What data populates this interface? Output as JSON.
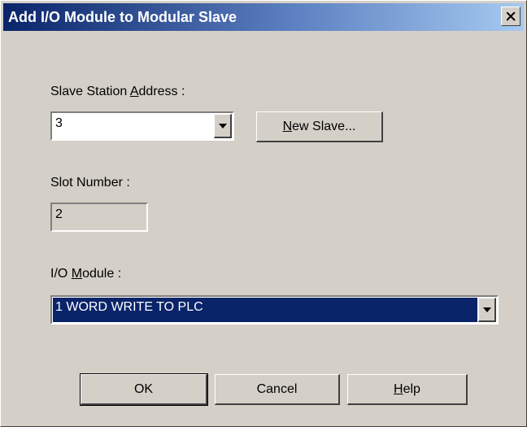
{
  "window": {
    "title": "Add I/O Module to Modular Slave"
  },
  "slave_address": {
    "label_before": "Slave Station ",
    "label_access": "A",
    "label_after": "ddress :",
    "value": "3"
  },
  "new_slave_button": {
    "access": "N",
    "rest": "ew Slave..."
  },
  "slot_number": {
    "label": "Slot Number :",
    "value": "2"
  },
  "io_module": {
    "label_before": "I/O ",
    "label_access": "M",
    "label_after": "odule :",
    "value": "1 WORD WRITE TO PLC"
  },
  "buttons": {
    "ok": "OK",
    "cancel": "Cancel",
    "help_access": "H",
    "help_rest": "elp"
  },
  "icons": {
    "close": "close-icon",
    "dropdown": "chevron-down-icon"
  },
  "colors": {
    "selection": "#0a246a",
    "dialog_face": "#d4d0c8"
  }
}
